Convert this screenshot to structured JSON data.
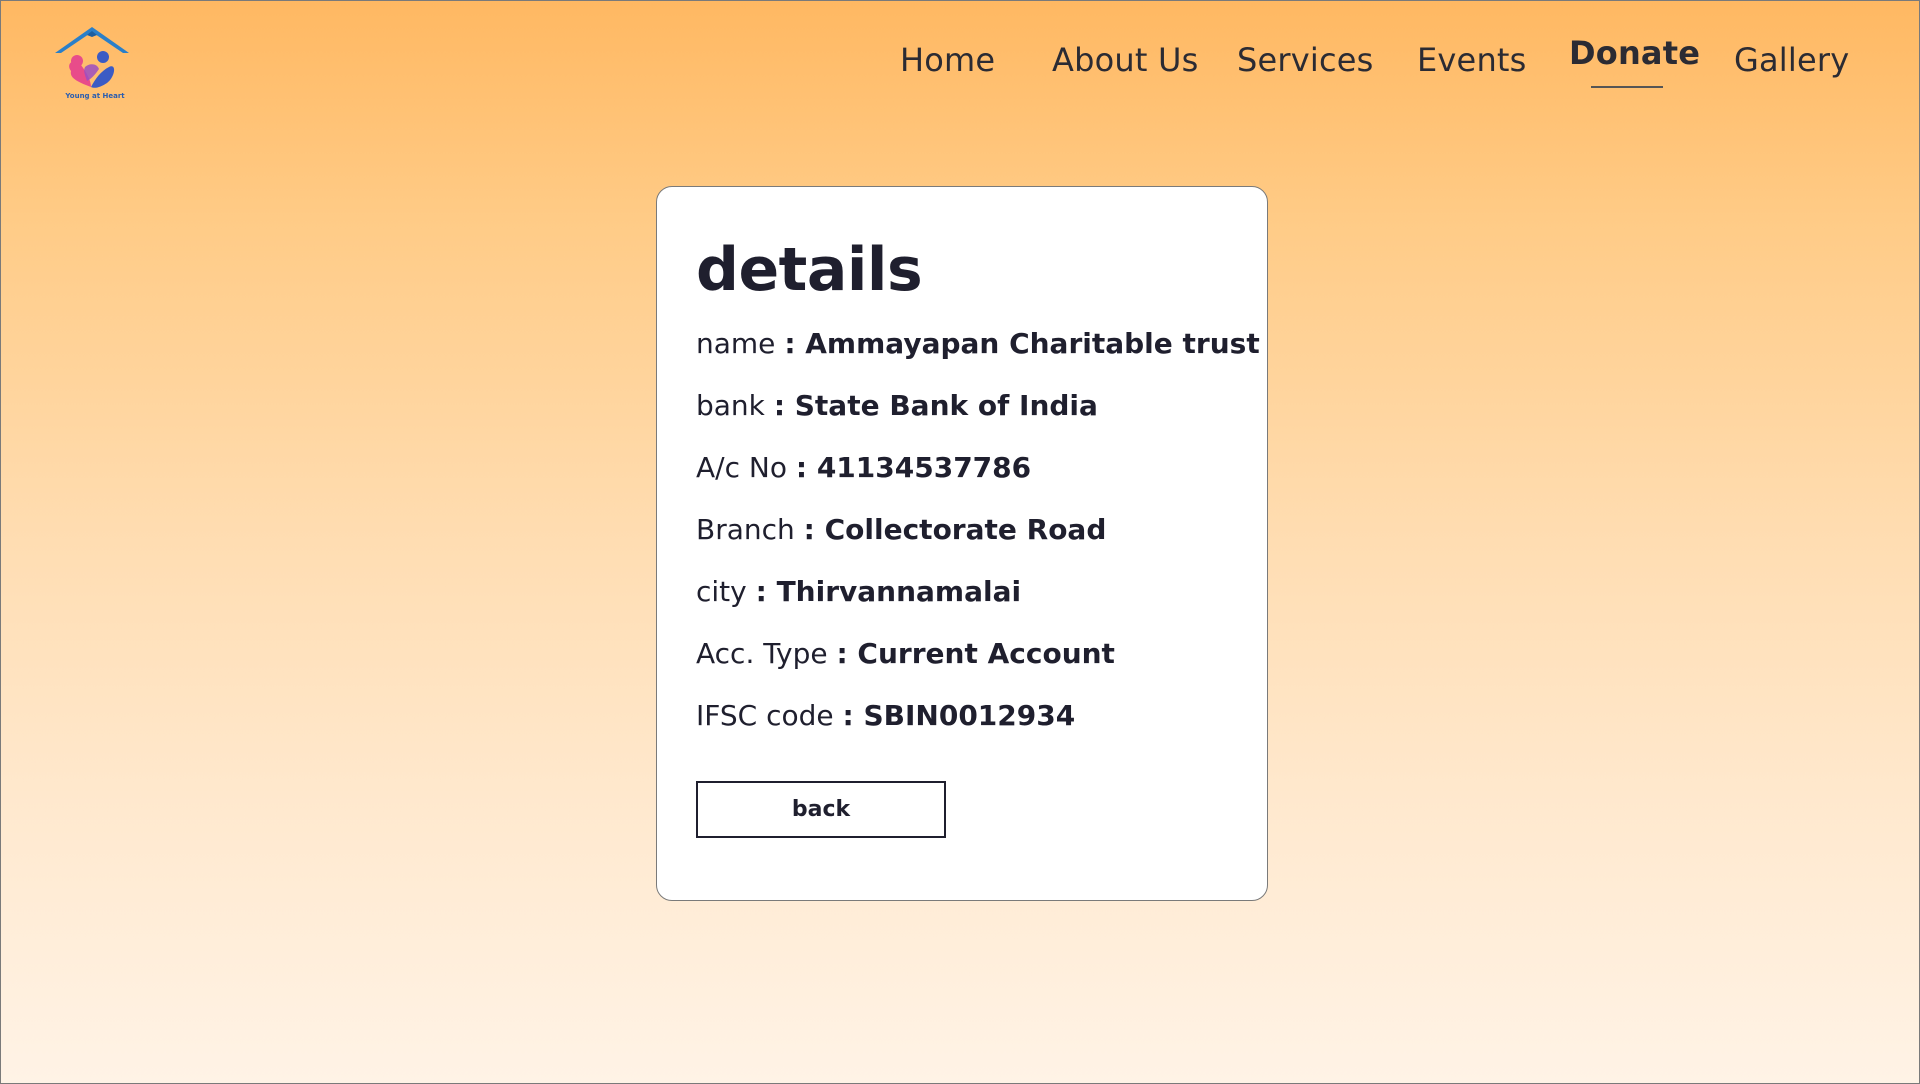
{
  "brand": {
    "logo_text": "Young at Heart"
  },
  "nav": {
    "items": [
      {
        "label": "Home"
      },
      {
        "label": "About Us"
      },
      {
        "label": "Services"
      },
      {
        "label": "Events"
      },
      {
        "label": "Donate",
        "active": true
      },
      {
        "label": "Gallery"
      }
    ]
  },
  "card": {
    "title": "details",
    "rows": [
      {
        "key": "name",
        "value": ": Ammayapan Charitable trust"
      },
      {
        "key": "bank",
        "value": ": State Bank of India"
      },
      {
        "key": "A/c No",
        "value": ": 41134537786"
      },
      {
        "key": "Branch",
        "value": ": Collectorate Road"
      },
      {
        "key": "city",
        "value": ": Thirvannamalai"
      },
      {
        "key": "Acc. Type",
        "value": ": Current Account"
      },
      {
        "key": "IFSC code",
        "value": ": SBIN0012934"
      }
    ],
    "back_label": "back"
  },
  "colors": {
    "gradient_top": "#ffb862",
    "gradient_bottom": "#fff3e6",
    "text": "#1f1f2e",
    "logo_roof": "#2a7fc9",
    "logo_pink": "#e84c8a",
    "logo_blue": "#3b5bc4"
  }
}
